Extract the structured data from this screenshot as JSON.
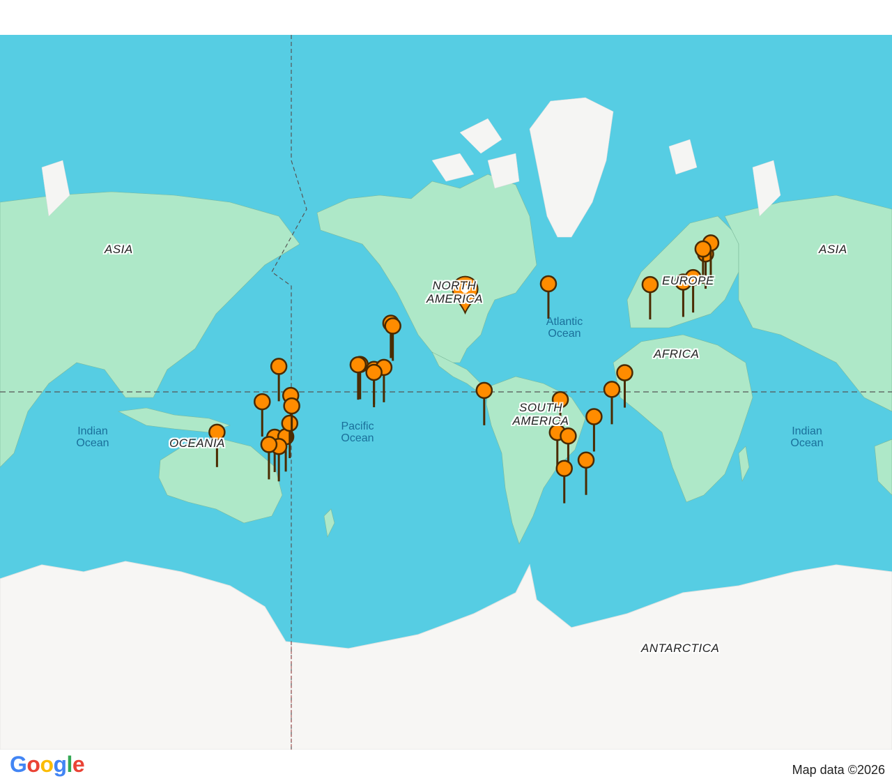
{
  "map": {
    "continent_labels": {
      "asia_left": "ASIA",
      "asia_right": "ASIA",
      "north_america": "NORTH AMERICA",
      "europe": "EUROPE",
      "africa": "AFRICA",
      "south_america": "SOUTH AMERICA",
      "oceania": "OCEANIA",
      "antarctica": "ANTARCTICA"
    },
    "ocean_labels": {
      "atlantic": "Atlantic Ocean",
      "pacific": "Pacific Ocean",
      "indian_left": "Indian Ocean",
      "indian_right": "Indian Ocean"
    },
    "colors": {
      "water": "#56cde3",
      "land": "#aee8c8",
      "ice": "#f5f5f3",
      "marker_fill": "#ff8c00",
      "marker_stroke": "#4a2a00"
    },
    "markers": [
      {
        "name": "marker-pacific-1",
        "lon": -156.5,
        "lat": 20.8
      },
      {
        "name": "marker-pacific-2",
        "lon": -155.5,
        "lat": 19.5
      },
      {
        "name": "marker-east-usa",
        "lon": -77,
        "lat": 38
      },
      {
        "name": "marker-azores",
        "lon": -25.7,
        "lat": 37.7
      },
      {
        "name": "marker-europe-1",
        "lon": -9,
        "lat": 38.7
      },
      {
        "name": "marker-europe-2",
        "lon": -4,
        "lat": 40.4
      },
      {
        "name": "marker-europe-3",
        "lon": 2.3,
        "lat": 48.9
      },
      {
        "name": "marker-europe-4",
        "lon": 4.9,
        "lat": 52.4
      },
      {
        "name": "marker-europe-5",
        "lon": 1,
        "lat": 50.5
      },
      {
        "name": "marker-brazil-ne",
        "lon": -38.5,
        "lat": -3.7
      },
      {
        "name": "marker-brazil-1",
        "lon": -45,
        "lat": -12
      },
      {
        "name": "marker-south-america-1",
        "lon": -71,
        "lat": -17
      },
      {
        "name": "marker-south-america-2",
        "lon": -54,
        "lat": -25
      },
      {
        "name": "marker-south-america-3",
        "lon": -72.5,
        "lat": -32
      },
      {
        "name": "marker-south-america-4",
        "lon": -67,
        "lat": -33.5
      },
      {
        "name": "marker-south-america-5",
        "lon": -58,
        "lat": -43
      },
      {
        "name": "marker-south-america-6",
        "lon": -69,
        "lat": -46
      },
      {
        "name": "marker-easter",
        "lon": -109.4,
        "lat": -12.5
      },
      {
        "name": "marker-samoa-1",
        "lon": -172,
        "lat": 0.5
      },
      {
        "name": "marker-samoa-2",
        "lon": -173,
        "lat": 0.3
      },
      {
        "name": "marker-samoa-3",
        "lon": -165,
        "lat": -2
      },
      {
        "name": "marker-samoa-4",
        "lon": -160,
        "lat": -1
      },
      {
        "name": "marker-samoa-5",
        "lon": -165,
        "lat": -3.5
      },
      {
        "name": "marker-png",
        "lon": 147,
        "lat": -0.5
      },
      {
        "name": "marker-aus-1",
        "lon": 153,
        "lat": -15
      },
      {
        "name": "marker-aus-2",
        "lon": 115.8,
        "lat": -31.9
      },
      {
        "name": "marker-aus-3",
        "lon": 138.6,
        "lat": -18
      },
      {
        "name": "marker-aus-4",
        "lon": 144.9,
        "lat": -34
      },
      {
        "name": "marker-aus-5",
        "lon": 150.5,
        "lat": -33.8
      },
      {
        "name": "marker-aus-6",
        "lon": 152.5,
        "lat": -28
      },
      {
        "name": "marker-aus-7",
        "lon": 153.5,
        "lat": -20
      },
      {
        "name": "marker-aus-8",
        "lon": 147,
        "lat": -37.8
      },
      {
        "name": "marker-aus-9",
        "lon": 142,
        "lat": -37
      }
    ],
    "selected_marker": {
      "name": "selected-location-pin",
      "lon": -119,
      "lat": 37
    }
  },
  "footer": {
    "google_letters": [
      "G",
      "o",
      "o",
      "g",
      "l",
      "e"
    ],
    "google_colors": [
      "#4285F4",
      "#EA4335",
      "#FBBC05",
      "#4285F4",
      "#34A853",
      "#EA4335"
    ],
    "map_data": "Map data ©2026"
  }
}
